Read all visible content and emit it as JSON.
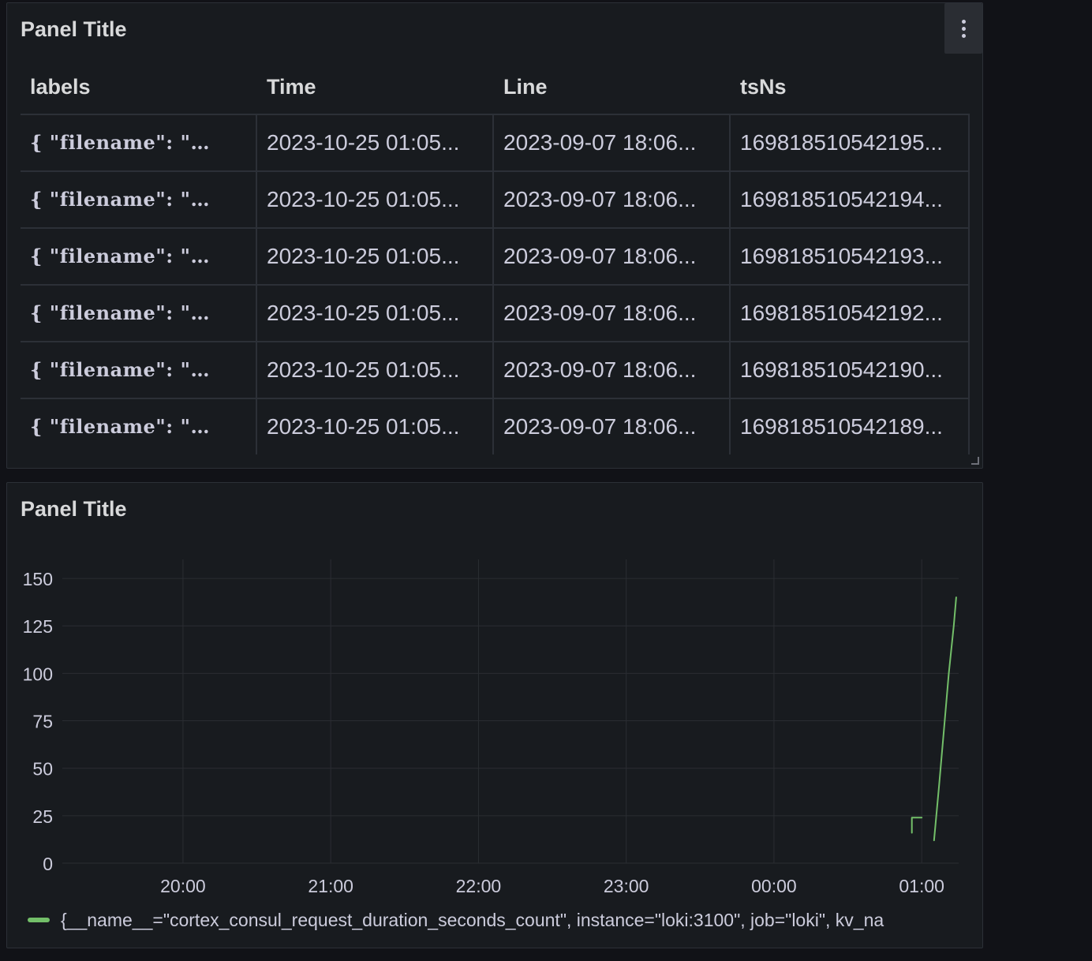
{
  "panels": [
    {
      "title": "Panel Title",
      "table": {
        "columns": [
          "labels",
          "Time",
          "Line",
          "tsNs"
        ],
        "rows": [
          [
            "{ \"filename\": \"…",
            "2023-10-25 01:05...",
            "2023-09-07 18:06...",
            "169818510542195..."
          ],
          [
            "{ \"filename\": \"…",
            "2023-10-25 01:05...",
            "2023-09-07 18:06...",
            "169818510542194..."
          ],
          [
            "{ \"filename\": \"…",
            "2023-10-25 01:05...",
            "2023-09-07 18:06...",
            "169818510542193..."
          ],
          [
            "{ \"filename\": \"…",
            "2023-10-25 01:05...",
            "2023-09-07 18:06...",
            "169818510542192..."
          ],
          [
            "{ \"filename\": \"…",
            "2023-10-25 01:05...",
            "2023-09-07 18:06...",
            "169818510542190..."
          ],
          [
            "{ \"filename\": \"…",
            "2023-10-25 01:05...",
            "2023-09-07 18:06...",
            "169818510542189..."
          ]
        ]
      },
      "menu_icon": "vertical-ellipsis-icon"
    },
    {
      "title": "Panel Title",
      "legend_text": "{__name__=\"cortex_consul_request_duration_seconds_count\", instance=\"loki:3100\", job=\"loki\", kv_na",
      "legend_color": "#73bf69"
    }
  ],
  "chart_data": {
    "type": "line",
    "title": "Panel Title",
    "x_ticks": [
      "20:00",
      "21:00",
      "22:00",
      "23:00",
      "00:00",
      "01:00"
    ],
    "y_ticks": [
      0,
      25,
      50,
      75,
      100,
      125,
      150
    ],
    "ylim": [
      0,
      160
    ],
    "xlim_hours": [
      "19:11",
      "01:15"
    ],
    "grid": true,
    "legend_placement": "bottom",
    "series": [
      {
        "name": "{__name__=\"cortex_consul_request_duration_seconds_count\", instance=\"loki:3100\", job=\"loki\", kv_na",
        "color": "#73bf69",
        "segments": [
          [
            [
              "00:56",
              16
            ],
            [
              "00:56",
              24
            ],
            [
              "01:00",
              24
            ]
          ],
          [
            [
              "01:05",
              12
            ],
            [
              "01:07",
              40
            ],
            [
              "01:09",
              70
            ],
            [
              "01:11",
              100
            ],
            [
              "01:13",
              125
            ],
            [
              "01:14",
              140
            ]
          ]
        ]
      }
    ]
  }
}
